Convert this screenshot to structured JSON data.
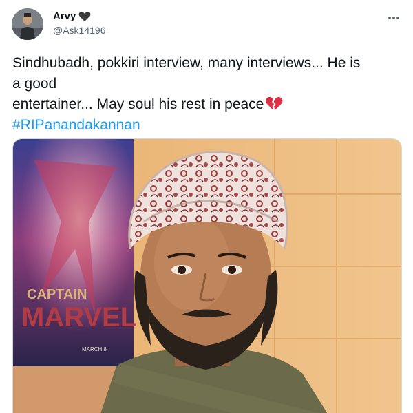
{
  "author": {
    "display_name": "Arvy",
    "handle": "@Ask14196",
    "badge_icon": "black-heart-icon"
  },
  "menu": {
    "more_icon": "more-horizontal-icon"
  },
  "tweet": {
    "line1": "Sindhubadh, pokkiri interview, many interviews... He is",
    "line2": "a good",
    "line3": "entertainer... May soul his rest in peace",
    "emoji_icon": "broken-heart-icon",
    "hashtag": "#RIPanandakannan"
  },
  "media": {
    "poster_text_top": "CAPTAIN",
    "poster_text_main": "MARVEL",
    "poster_text_date": "MARCH 8"
  },
  "colors": {
    "text": "#0f1419",
    "secondary": "#536471",
    "link": "#1d9bf0",
    "broken_heart": "#dd2e44"
  }
}
